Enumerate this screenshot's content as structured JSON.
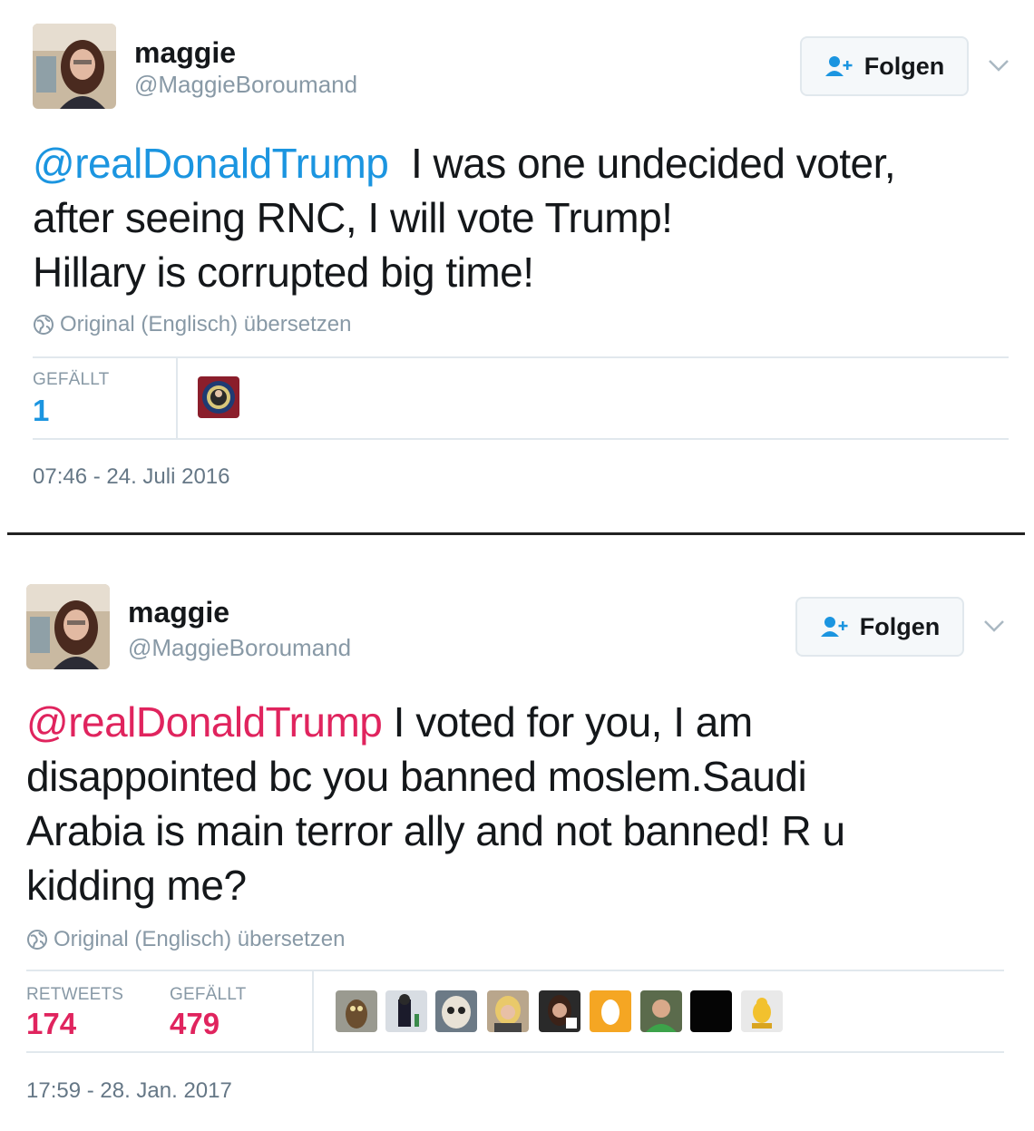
{
  "tweets": [
    {
      "user": {
        "name": "maggie",
        "handle": "@MaggieBoroumand"
      },
      "follow_label": "Folgen",
      "mention": "@realDonaldTrump",
      "text_lines": [
        "I was one undecided voter,",
        "after seeing RNC, I will vote Trump!",
        "Hillary is corrupted big time!"
      ],
      "translate_label": "Original (Englisch) übersetzen",
      "likes_label": "GEFÄLLT",
      "likes": "1",
      "timestamp": "07:46 - 24. Juli 2016",
      "accent": "#1b95e0"
    },
    {
      "user": {
        "name": "maggie",
        "handle": "@MaggieBoroumand"
      },
      "follow_label": "Folgen",
      "mention": "@realDonaldTrump",
      "text_first": " I voted for you, I am",
      "text_lines": [
        "disappointed bc you banned moslem.Saudi",
        "Arabia is main terror ally and not banned! R u",
        "kidding me?"
      ],
      "translate_label": "Original (Englisch) übersetzen",
      "retweets_label": "RETWEETS",
      "retweets": "174",
      "likes_label": "GEFÄLLT",
      "likes": "479",
      "timestamp": "17:59 - 28. Jan. 2017",
      "accent": "#e0245e"
    }
  ],
  "icons": [
    "add-user-icon",
    "chevron-down-icon",
    "globe-icon"
  ]
}
